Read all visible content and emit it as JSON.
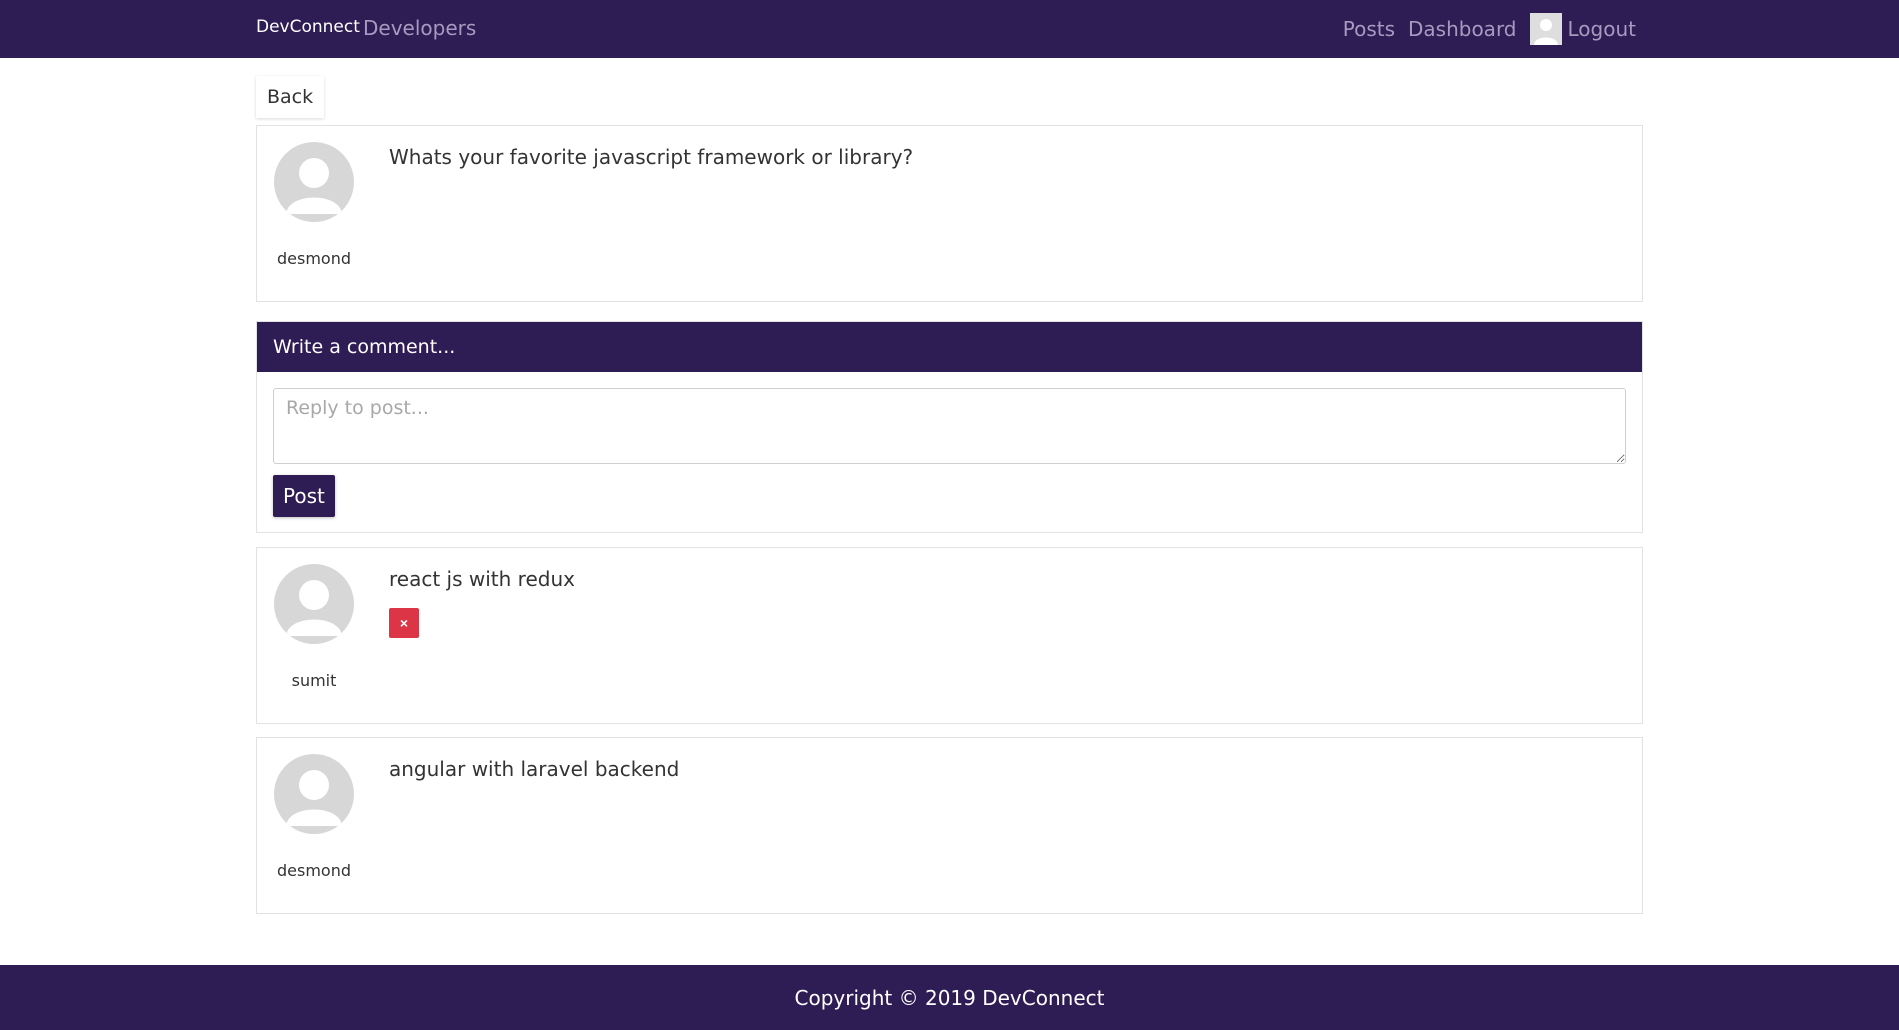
{
  "navbar": {
    "brand": "DevConnect",
    "developers_label": "Developers",
    "posts_label": "Posts",
    "dashboard_label": "Dashboard",
    "logout_label": "Logout"
  },
  "back_label": "Back",
  "post": {
    "text": "Whats your favorite javascript framework or library?",
    "author": "desmond"
  },
  "comment_form": {
    "header": "Write a comment...",
    "placeholder": "Reply to post...",
    "submit_label": "Post"
  },
  "comments": [
    {
      "text": "react js with redux",
      "author": "sumit",
      "delete_label": "×"
    },
    {
      "text": "angular with laravel backend",
      "author": "desmond"
    }
  ],
  "footer": {
    "copyright": "Copyright © 2019 DevConnect"
  },
  "colors": {
    "primary": "#2e1c55",
    "danger": "#dc3545",
    "nav_link": "#a59bbf"
  }
}
